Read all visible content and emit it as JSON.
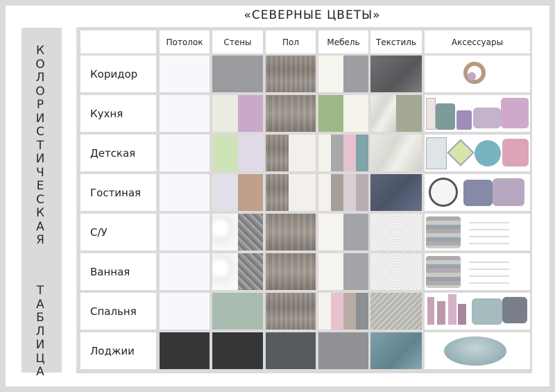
{
  "title": "«СЕВЕРНЫЕ ЦВЕТЫ»",
  "sidebar": {
    "word1": "КОЛОРИСТИЧЕСКАЯ",
    "word2": "ТАБЛИЦА"
  },
  "headers": [
    "Потолок",
    "Стены",
    "Пол",
    "Мебель",
    "Текстиль",
    "Аксессуары"
  ],
  "rows": [
    {
      "label": "Коридор"
    },
    {
      "label": "Кухня"
    },
    {
      "label": "Детская"
    },
    {
      "label": "Гостиная"
    },
    {
      "label": "С/У"
    },
    {
      "label": "Ванная"
    },
    {
      "label": "Спальня"
    },
    {
      "label": "Лоджии"
    }
  ],
  "colors": {
    "page_bg": "#dcd9da",
    "ceiling_white": "#f7f8fc",
    "dark_graphite": "#353638",
    "slate": "#565b60",
    "steel_grey": "#8f9197",
    "mint_grey": "#a9bcb0",
    "lilac": "#c8a9cb",
    "pistachio": "#cfe3b9",
    "peach_taupe": "#c0a08a",
    "sage": "#9cb985",
    "teal_grey": "#7fa3a7",
    "pink": "#e6c2cf",
    "denim": "#5b6478"
  }
}
